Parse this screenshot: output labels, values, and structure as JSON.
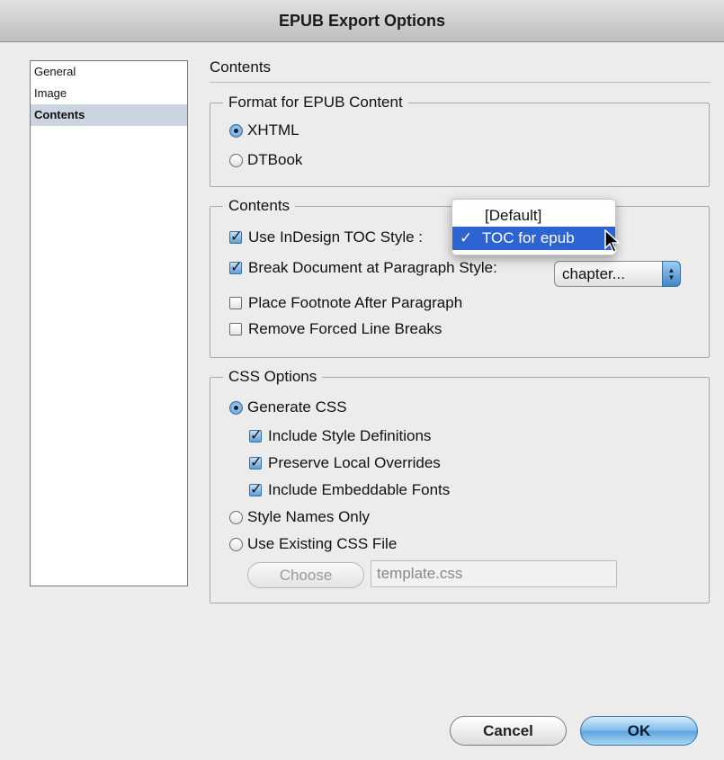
{
  "window": {
    "title": "EPUB Export Options"
  },
  "sidebar": {
    "items": [
      {
        "label": "General",
        "selected": false
      },
      {
        "label": "Image",
        "selected": false
      },
      {
        "label": "Contents",
        "selected": true
      }
    ]
  },
  "page": {
    "heading": "Contents"
  },
  "format_group": {
    "legend": "Format for EPUB Content",
    "options": [
      {
        "label": "XHTML",
        "selected": true
      },
      {
        "label": "DTBook",
        "selected": false
      }
    ]
  },
  "contents_group": {
    "legend": "Contents",
    "use_toc": {
      "label": "Use InDesign TOC Style :",
      "checked": true
    },
    "toc_popup": {
      "options": [
        "[Default]",
        "TOC for epub"
      ],
      "selected": "TOC for epub",
      "check_mark": "✓"
    },
    "break_doc": {
      "label": "Break Document at Paragraph Style:",
      "checked": true,
      "value": "chapter..."
    },
    "place_footnote": {
      "label": "Place Footnote After Paragraph",
      "checked": false
    },
    "remove_breaks": {
      "label": "Remove Forced Line Breaks",
      "checked": false
    }
  },
  "css_group": {
    "legend": "CSS Options",
    "generate": {
      "label": "Generate CSS",
      "selected": true
    },
    "include_styles": {
      "label": "Include Style Definitions",
      "checked": true
    },
    "preserve_overrides": {
      "label": "Preserve Local Overrides",
      "checked": true
    },
    "include_fonts": {
      "label": "Include Embeddable Fonts",
      "checked": true
    },
    "style_names": {
      "label": "Style Names Only",
      "selected": false
    },
    "use_existing": {
      "label": "Use Existing CSS File",
      "selected": false
    },
    "choose_label": "Choose",
    "css_file": "template.css"
  },
  "footer": {
    "cancel_label": "Cancel",
    "ok_label": "OK"
  },
  "colors": {
    "selection_blue": "#2e63d3",
    "sidebar_selected": "#ccd4e1",
    "ok_blue": "#5aa4de"
  }
}
